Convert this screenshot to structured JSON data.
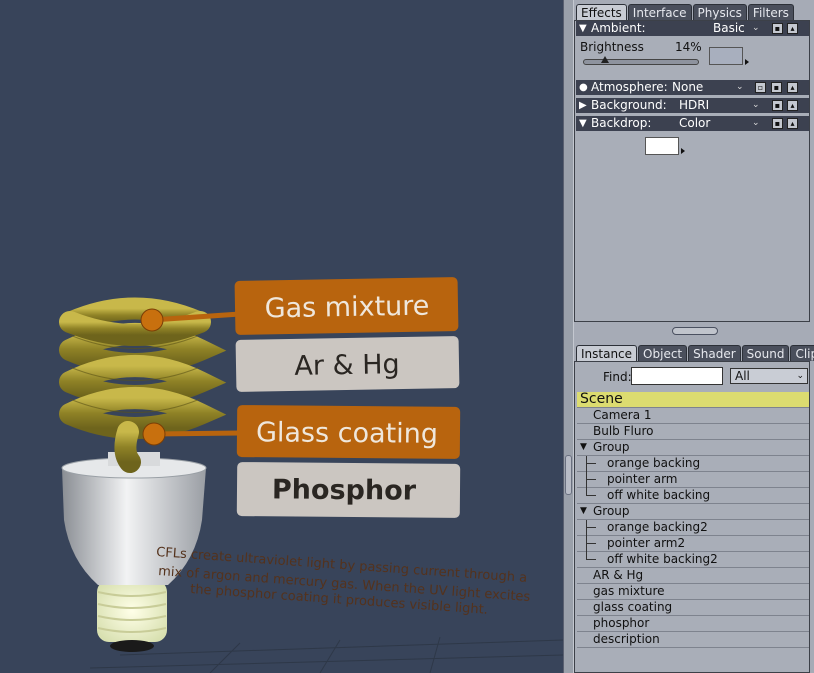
{
  "effects_panel": {
    "tabs": [
      "Effects",
      "Interface",
      "Physics",
      "Filters"
    ],
    "ambient": {
      "label": "Ambient:",
      "mode": "Basic"
    },
    "brightness": {
      "label": "Brightness",
      "value_text": "14%",
      "value": 14
    },
    "atmosphere": {
      "label": "Atmosphere:",
      "mode": "None"
    },
    "background": {
      "label": "Background:",
      "mode": "HDRI"
    },
    "backdrop": {
      "label": "Backdrop:",
      "mode": "Color",
      "color": "#ffffff"
    }
  },
  "scene_panel": {
    "tabs": [
      "Instance",
      "Object",
      "Shader",
      "Sound",
      "Clips"
    ],
    "find_label": "Find:",
    "find_value": "",
    "filter": "All",
    "tree": [
      {
        "label": "Scene",
        "level": 0,
        "kind": "scene"
      },
      {
        "label": "Camera 1",
        "level": 1
      },
      {
        "label": "Bulb Fluro",
        "level": 1
      },
      {
        "label": "Group",
        "level": 1,
        "kind": "group"
      },
      {
        "label": "orange backing",
        "level": 2
      },
      {
        "label": "pointer arm",
        "level": 2
      },
      {
        "label": "off white backing",
        "level": 2,
        "last": true
      },
      {
        "label": "Group",
        "level": 1,
        "kind": "group"
      },
      {
        "label": "orange backing2",
        "level": 2
      },
      {
        "label": "pointer arm2",
        "level": 2
      },
      {
        "label": "off white backing2",
        "level": 2,
        "last": true
      },
      {
        "label": "AR & Hg",
        "level": 1
      },
      {
        "label": "gas mixture",
        "level": 1
      },
      {
        "label": "glass coating",
        "level": 1
      },
      {
        "label": "phosphor",
        "level": 1
      },
      {
        "label": "description",
        "level": 1
      }
    ]
  },
  "viewport": {
    "labels": {
      "gas_mixture": "Gas mixture",
      "ar_hg": "Ar & Hg",
      "glass_coating": "Glass coating",
      "phosphor": "Phosphor"
    },
    "description_lines": [
      "CFLs create ultraviolet light by passing current through a",
      "mix of argon and mercury gas. When the UV light excites",
      "the phosphor coating it produces visible light."
    ],
    "colors": {
      "orange": "#b8640e",
      "offwhite": "#ccc7c2",
      "bg": "#38445a",
      "tube": "#a89a2c"
    }
  }
}
